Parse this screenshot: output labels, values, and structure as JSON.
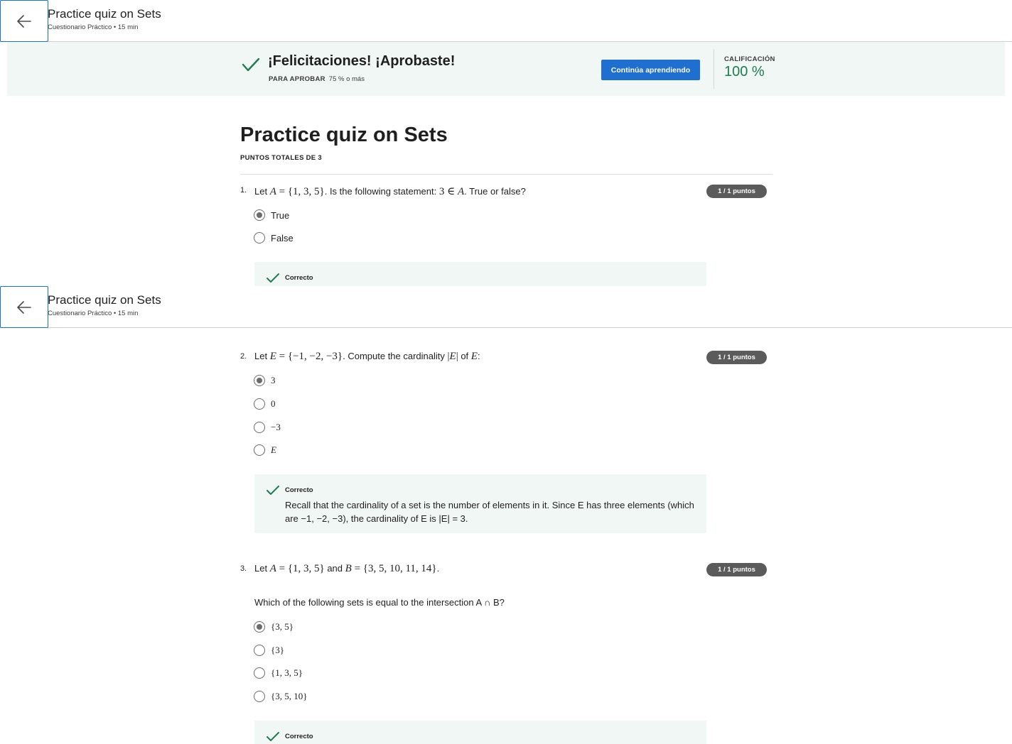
{
  "header": {
    "title": "Practice quiz on Sets",
    "subtitle": "Cuestionario Práctico • 15 min"
  },
  "banner": {
    "title": "¡Felicitaciones! ¡Aprobaste!",
    "pass_label": "PARA APROBAR",
    "pass_value": "75 % o más",
    "continue_label": "Continúa aprendiendo",
    "grade_label": "CALIFICACIÓN",
    "grade_value": "100 %"
  },
  "quiz": {
    "title": "Practice quiz on Sets",
    "total_points": "PUNTOS TOTALES DE 3"
  },
  "questions": [
    {
      "number": "1.",
      "points": "1 / 1 puntos",
      "options": [
        "True",
        "False"
      ],
      "selected_index": 0,
      "feedback_title": "Correcto"
    },
    {
      "number": "2.",
      "points": "1 / 1 puntos",
      "options": [
        "3",
        "0",
        "−3",
        "E"
      ],
      "selected_index": 0,
      "feedback_title": "Correcto",
      "feedback_text": "Recall that the cardinality of a set is the number of elements in it. Since E has three elements (which are −1, −2, −3), the cardinality of E is |E| = 3."
    },
    {
      "number": "3.",
      "points": "1 / 1 puntos",
      "prompt": "Which of the following sets is equal to the intersection A ∩ B?",
      "options": [
        "{3, 5}",
        "{3}",
        "{1, 3, 5}",
        "{3, 5, 10}"
      ],
      "selected_index": 0,
      "feedback_title": "Correcto"
    }
  ],
  "colors": {
    "accent": "#1f6fd1",
    "success": "#1d7c50",
    "banner_bg": "#f1f7f5",
    "badge_bg": "#5b5b5b"
  }
}
